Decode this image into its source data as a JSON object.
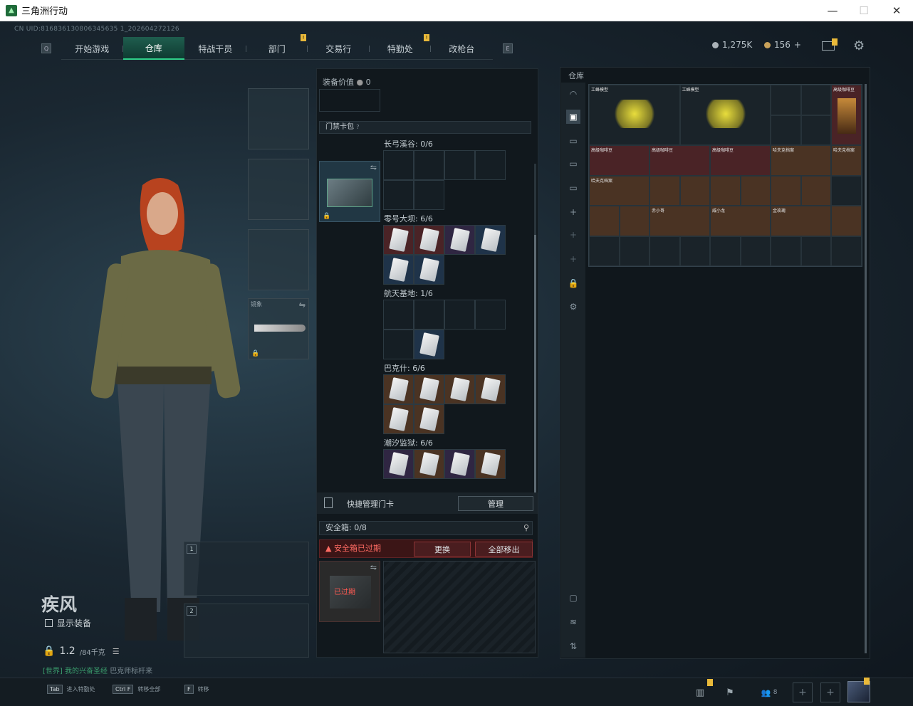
{
  "window": {
    "title": "三角洲行动",
    "minimize": "—",
    "maximize": "☐",
    "close": "✕"
  },
  "uid": "CN UID:816836130806345635 1_202604272126",
  "nav": {
    "tabs": [
      "开始游戏",
      "仓库",
      "特战干员",
      "部门",
      "交易行",
      "特勤处",
      "改枪台"
    ],
    "active": "仓库"
  },
  "currency": {
    "silver": "1,275K",
    "gold": "156",
    "gold_plus": "+"
  },
  "character": {
    "name": "疾风",
    "show_gear_label": "显示装备",
    "weight": "1.2",
    "weight_cap": "/84千克"
  },
  "chat": {
    "channel": "[世界]",
    "sender": "我的兴奋圣经",
    "message": "巴克师标杆来"
  },
  "bottom_keys": [
    {
      "key": "Tab",
      "label": "进入特勤处"
    },
    {
      "key": "Ctrl F",
      "label": "转移全部"
    },
    {
      "key": "F",
      "label": "转移"
    }
  ],
  "loadout": {
    "equip_value_label": "装备价值",
    "equip_value": "0",
    "melee_label": "镜象",
    "card_bag_label": "门禁卡包",
    "card_bag_hint": "?",
    "groups": [
      {
        "title": "长弓溪谷: 0/6"
      },
      {
        "title": "零号大坝: 6/6"
      },
      {
        "title": "航天基地: 1/6"
      },
      {
        "title": "巴克什: 6/6"
      },
      {
        "title": "潮汐监狱: 6/6"
      }
    ],
    "quick_manage_label": "快捷管理门卡",
    "manage_button": "管理",
    "safebox_label": "安全箱:",
    "safebox_value": "0/8",
    "safebox_expired": "安全箱已过期",
    "replace_button": "更换",
    "remove_all_button": "全部移出",
    "safecase_overlay": "已过期"
  },
  "stash": {
    "title": "仓库",
    "items": [
      "工蜂模型",
      "工蜂模型",
      "高级咖啡豆",
      "高级咖啡豆",
      "高级咖啡豆",
      "高级咖啡豆",
      "哈夫克档案",
      "哈夫克档案",
      "哈夫克档案",
      "赤小哥",
      "威小龙",
      "金玫瑰"
    ]
  },
  "bottom_right": {
    "squad_count": "8"
  },
  "colors": {
    "accent": "#2fd08a",
    "warning": "#e9b93a",
    "danger": "#ff6b63"
  }
}
